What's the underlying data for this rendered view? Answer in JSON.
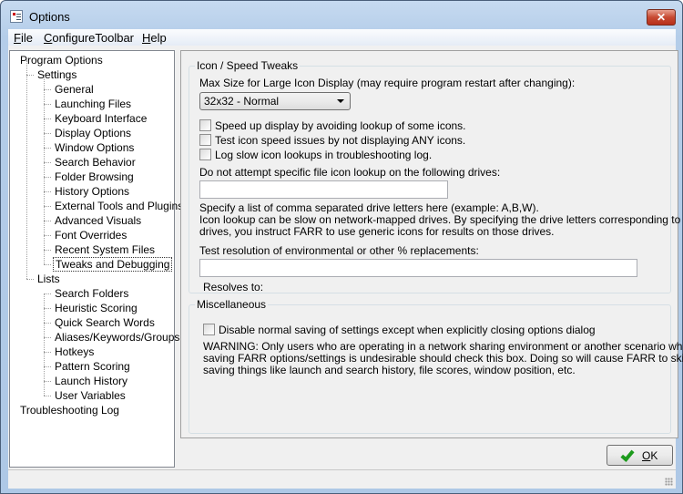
{
  "window": {
    "title": "Options",
    "close_label": "✕"
  },
  "menu": [
    {
      "label": "File",
      "key": "F",
      "rest": "ile"
    },
    {
      "label": "ConfigureToolbar",
      "key": "C",
      "rest": "onfigureToolbar"
    },
    {
      "label": "Help",
      "key": "H",
      "rest": "elp"
    }
  ],
  "tree": [
    {
      "label": "Program Options",
      "level": 0
    },
    {
      "label": "Settings",
      "level": 1
    },
    {
      "label": "General",
      "level": 2
    },
    {
      "label": "Launching Files",
      "level": 2
    },
    {
      "label": "Keyboard Interface",
      "level": 2
    },
    {
      "label": "Display Options",
      "level": 2
    },
    {
      "label": "Window Options",
      "level": 2
    },
    {
      "label": "Search Behavior",
      "level": 2
    },
    {
      "label": "Folder Browsing",
      "level": 2
    },
    {
      "label": "History Options",
      "level": 2
    },
    {
      "label": "External Tools and Plugins",
      "level": 2
    },
    {
      "label": "Advanced Visuals",
      "level": 2
    },
    {
      "label": "Font Overrides",
      "level": 2
    },
    {
      "label": "Recent System Files",
      "level": 2
    },
    {
      "label": "Tweaks and Debugging",
      "level": 2,
      "selected": true
    },
    {
      "label": "Lists",
      "level": 1
    },
    {
      "label": "Search Folders",
      "level": 2
    },
    {
      "label": "Heuristic Scoring",
      "level": 2
    },
    {
      "label": "Quick Search Words",
      "level": 2
    },
    {
      "label": "Aliases/Keywords/Groups",
      "level": 2
    },
    {
      "label": "Hotkeys",
      "level": 2
    },
    {
      "label": "Pattern Scoring",
      "level": 2
    },
    {
      "label": "Launch History",
      "level": 2
    },
    {
      "label": "User Variables",
      "level": 2
    },
    {
      "label": "Troubleshooting Log",
      "level": 0
    }
  ],
  "icon_group": {
    "title": "Icon / Speed Tweaks",
    "max_size_label": "Max Size for Large Icon Display (may require program restart after changing):",
    "max_size_value": "32x32 - Normal",
    "checkboxes": [
      {
        "label": "Speed up display by avoiding lookup of some icons.",
        "checked": false
      },
      {
        "label": "Test icon speed issues by not displaying ANY icons.",
        "checked": false
      },
      {
        "label": "Log slow icon lookups in troubleshooting log.",
        "checked": false
      }
    ],
    "drives_label": "Do not attempt specific file icon lookup on the following drives:",
    "drives_value": "",
    "drives_help": [
      "Specify a list of comma separated drive letters here (example: A,B,W).",
      "Icon lookup can be slow on network-mapped drives. By specifying the drive letters corresponding to such",
      "drives, you instruct FARR to use generic icons for results on those drives."
    ],
    "test_label": "Test resolution of environmental or other % replacements:",
    "test_value": "",
    "resolves_label": "Resolves to:"
  },
  "misc_group": {
    "title": "Miscellaneous",
    "checkbox": {
      "label": "Disable normal saving of settings except when explicitly closing options dialog",
      "checked": false
    },
    "warning": [
      "WARNING: Only users who are operating in a network sharing environment or another scenario where",
      "saving FARR options/settings is undesirable should check this box.  Doing so will cause FARR to skip",
      "saving things like launch and search history, file scores, window position, etc."
    ]
  },
  "ok_button": {
    "key": "O",
    "rest": "K",
    "icon": "checkmark-icon"
  }
}
